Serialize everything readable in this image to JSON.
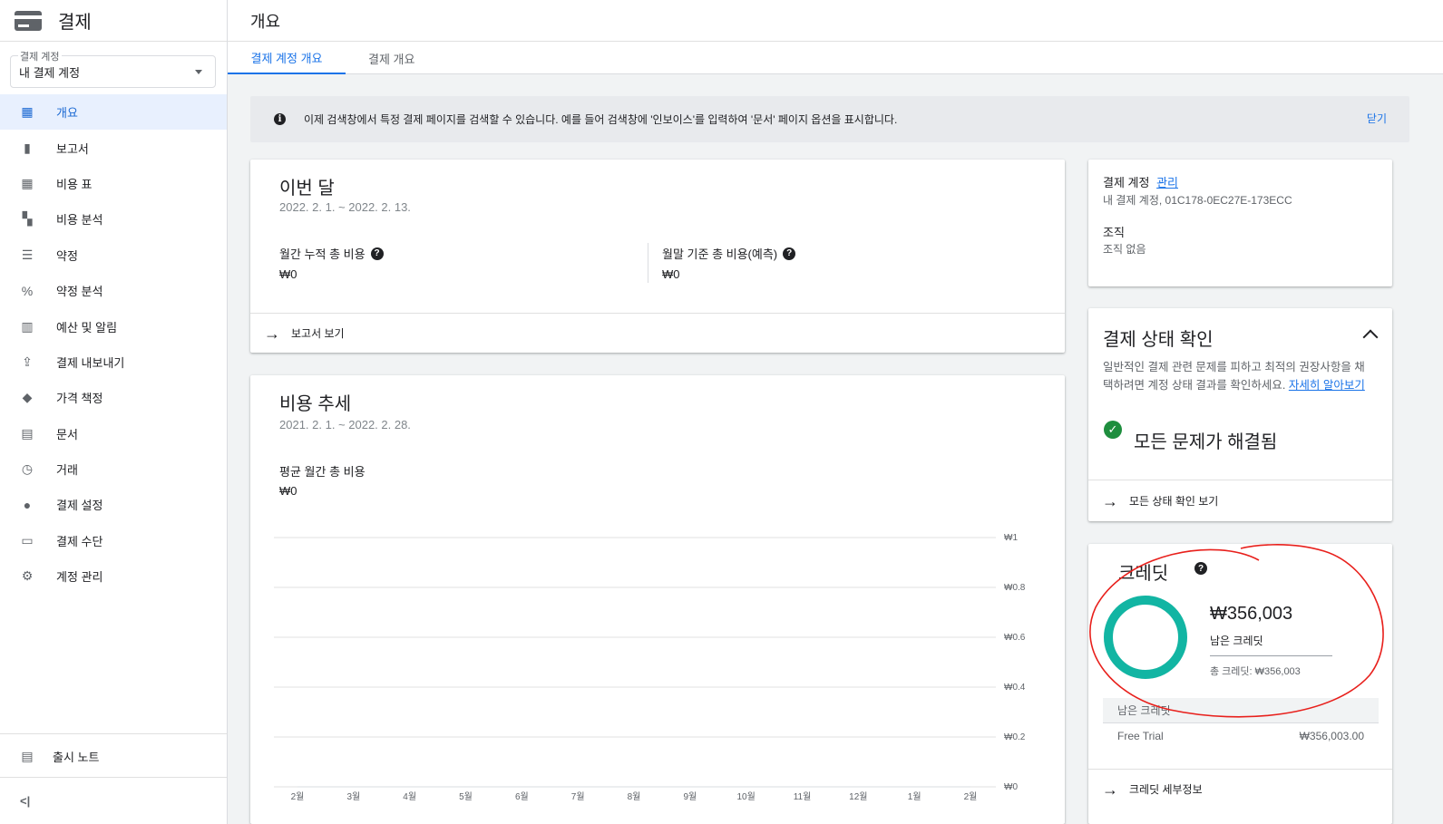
{
  "app": {
    "title": "결제"
  },
  "account": {
    "label": "결제 계정",
    "value": "내 결제 계정"
  },
  "nav": [
    {
      "label": "개요",
      "icon": "dashboard-icon",
      "glyph": "▦"
    },
    {
      "label": "보고서",
      "icon": "bar-chart-icon",
      "glyph": "▮"
    },
    {
      "label": "비용 표",
      "icon": "table-icon",
      "glyph": "▦"
    },
    {
      "label": "비용 분석",
      "icon": "waterfall-chart-icon",
      "glyph": "▚"
    },
    {
      "label": "약정",
      "icon": "list-icon",
      "glyph": "☰"
    },
    {
      "label": "약정 분석",
      "icon": "percent-icon",
      "glyph": "%"
    },
    {
      "label": "예산 및 알림",
      "icon": "budget-icon",
      "glyph": "▥"
    },
    {
      "label": "결제 내보내기",
      "icon": "upload-icon",
      "glyph": "⇪"
    },
    {
      "label": "가격 책정",
      "icon": "tag-icon",
      "glyph": "◆"
    },
    {
      "label": "문서",
      "icon": "document-icon",
      "glyph": "▤"
    },
    {
      "label": "거래",
      "icon": "clock-icon",
      "glyph": "◷"
    },
    {
      "label": "결제 설정",
      "icon": "person-icon",
      "glyph": "●"
    },
    {
      "label": "결제 수단",
      "icon": "credit-card-icon",
      "glyph": "▭"
    },
    {
      "label": "계정 관리",
      "icon": "gear-icon",
      "glyph": "⚙"
    }
  ],
  "footer": {
    "release_notes": "출시 노트",
    "collapse": "<|"
  },
  "page": {
    "title": "개요"
  },
  "tabs": [
    {
      "label": "결제 계정 개요"
    },
    {
      "label": "결제 개요"
    }
  ],
  "banner": {
    "text": "이제 검색창에서 특정 결제 페이지를 검색할 수 있습니다. 예를 들어 검색창에 '인보이스'를 입력하여 '문서' 페이지 옵션을 표시합니다.",
    "close": "닫기"
  },
  "this_month": {
    "title": "이번 달",
    "date_range": "2022. 2. 1. ~ 2022. 2. 13.",
    "mtd_label": "월간 누적 총 비용",
    "mtd_value": "₩0",
    "forecast_label": "월말 기준 총 비용(예측)",
    "forecast_value": "₩0",
    "action": "보고서 보기"
  },
  "cost_trend": {
    "title": "비용 추세",
    "date_range": "2021. 2. 1. ~ 2022. 2. 28.",
    "avg_label": "평균 월간 총 비용",
    "avg_value": "₩0"
  },
  "chart_data": {
    "type": "line",
    "x": [
      "2월",
      "3월",
      "4월",
      "5월",
      "6월",
      "7월",
      "8월",
      "9월",
      "10월",
      "11월",
      "12월",
      "1월",
      "2월"
    ],
    "y_ticks": [
      "₩0",
      "₩0.2",
      "₩0.4",
      "₩0.6",
      "₩0.8",
      "₩1"
    ],
    "ylim": [
      0,
      1
    ],
    "series": [
      {
        "values": [
          0,
          0,
          0,
          0,
          0,
          0,
          0,
          0,
          0,
          0,
          0,
          0,
          0
        ]
      }
    ],
    "grid": true
  },
  "account_info": {
    "label": "결제 계정",
    "manage": "관리",
    "value": "내 결제 계정, 01C178-0EC27E-173ECC",
    "org_label": "조직",
    "org_value": "조직 없음"
  },
  "health": {
    "title": "결제 상태 확인",
    "desc": "일반적인 결제 관련 문제를 피하고 최적의 권장사항을 채택하려면 계정 상태 결과를 확인하세요.",
    "learn_more": "자세히 알아보기",
    "status": "모든 문제가 해결됨",
    "action": "모든 상태 확인 보기",
    "status_color": "#1e8e3e"
  },
  "credits": {
    "title": "크레딧",
    "amount": "₩356,003",
    "remaining_label": "남은 크레딧",
    "total": "총 크레딧: ₩356,003",
    "remaining_fraction": 1.0,
    "ring_color": "#12b5a3",
    "table_header": "남은 크레딧",
    "rows": [
      {
        "name": "Free Trial",
        "value": "₩356,003.00"
      }
    ],
    "action": "크레딧 세부정보"
  }
}
